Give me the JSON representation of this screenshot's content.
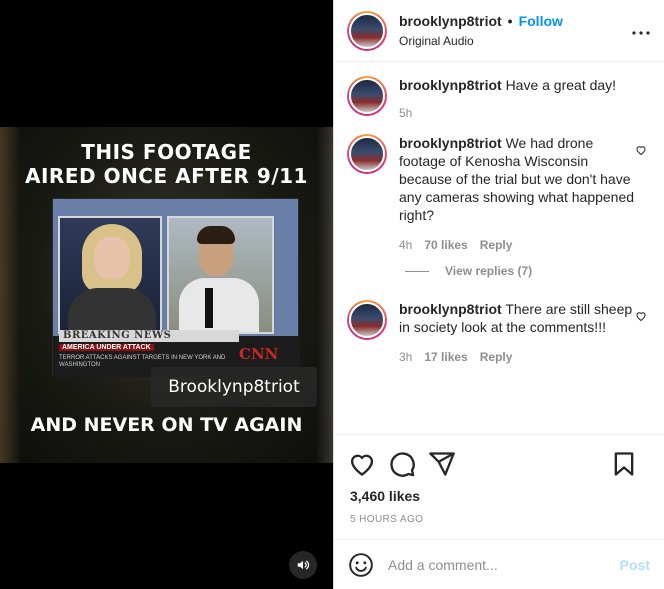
{
  "video": {
    "caption_top": "THIS FOOTAGE\nAIRED ONCE AFTER 9/11",
    "breaking": "BREAKING NEWS",
    "america": "AMERICA UNDER ATTACK",
    "terror": "TERROR ATTACKS AGAINST TARGETS IN NEW YORK AND WASHINGTON",
    "network": "CNN",
    "watermark": "Brooklynp8triot",
    "caption_bottom": "AND NEVER ON TV AGAIN"
  },
  "header": {
    "username": "brooklynp8triot",
    "separator": "•",
    "follow_label": "Follow",
    "audio": "Original Audio",
    "more": "•••"
  },
  "comments": [
    {
      "username": "brooklynp8triot",
      "text": "Have a great day!",
      "time": "5h",
      "likes": "",
      "reply": ""
    },
    {
      "username": "brooklynp8triot",
      "text": "We had drone footage of Kenosha Wisconsin because of the trial but we don't have any cameras showing what happened right?",
      "time": "4h",
      "likes": "70 likes",
      "reply": "Reply",
      "view_replies": "View replies (7)"
    },
    {
      "username": "brooklynp8triot",
      "text": "There are still sheep in society look at the comments!!!",
      "time": "3h",
      "likes": "17 likes",
      "reply": "Reply"
    }
  ],
  "footer": {
    "likes": "3,460 likes",
    "ago": "5 HOURS AGO",
    "add_comment_placeholder": "Add a comment...",
    "post_label": "Post"
  },
  "colors": {
    "accent": "#0095f6",
    "post_disabled": "#b2dffc",
    "muted": "#8e8e8e"
  }
}
